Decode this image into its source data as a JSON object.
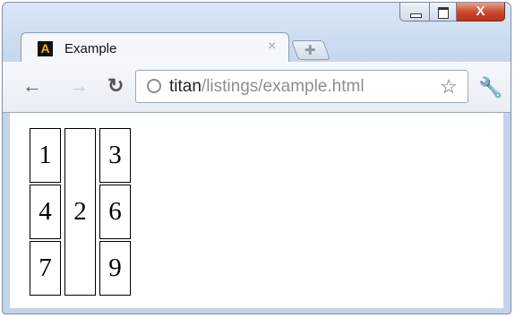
{
  "window": {
    "controls": {
      "minimize": "minimize",
      "maximize": "maximize",
      "close": "X"
    }
  },
  "tab": {
    "favicon_letter": "A",
    "title": "Example",
    "close": "×"
  },
  "toolbar": {
    "back_icon": "arrow-left-icon",
    "forward_icon": "arrow-right-icon",
    "reload_icon": "reload-icon",
    "url_host": "titan",
    "url_path": "/listings/example.html",
    "bookmark_icon": "star-icon",
    "menu_icon": "wrench-icon"
  },
  "grid": {
    "cells": [
      "1",
      "2",
      "3",
      "4",
      "6",
      "7",
      "9"
    ]
  }
}
